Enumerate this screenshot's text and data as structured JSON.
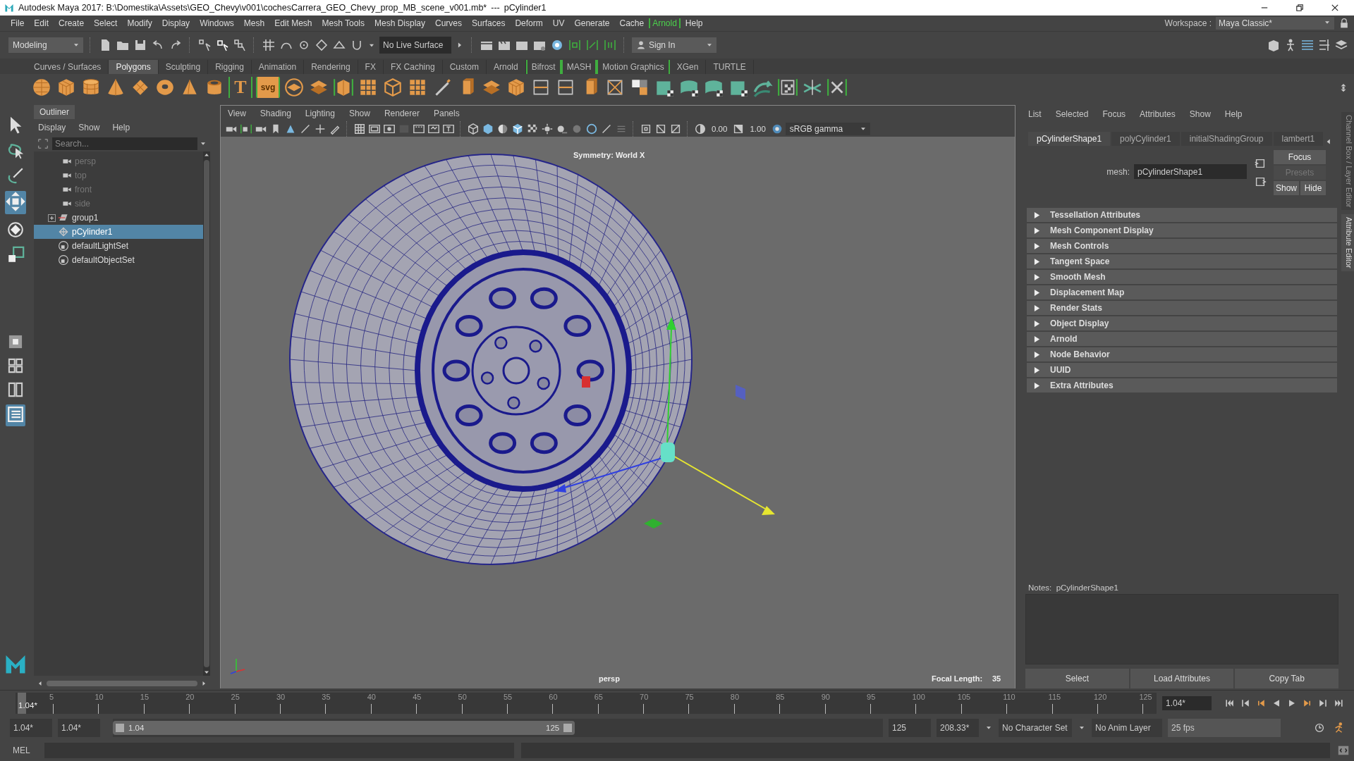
{
  "title_bar": {
    "title": "Autodesk Maya 2017: B:\\Domestika\\Assets\\GEO_Chevy\\v001\\cochesCarrera_GEO_Chevy_prop_MB_scene_v001.mb*",
    "separator": "---",
    "object": "pCylinder1"
  },
  "menu_bar": [
    {
      "label": "File",
      "highlighted": false
    },
    {
      "label": "Edit",
      "highlighted": false
    },
    {
      "label": "Create",
      "highlighted": false
    },
    {
      "label": "Select",
      "highlighted": false
    },
    {
      "label": "Modify",
      "highlighted": false
    },
    {
      "label": "Display",
      "highlighted": false
    },
    {
      "label": "Windows",
      "highlighted": false
    },
    {
      "label": "Mesh",
      "highlighted": false
    },
    {
      "label": "Edit Mesh",
      "highlighted": false
    },
    {
      "label": "Mesh Tools",
      "highlighted": false
    },
    {
      "label": "Mesh Display",
      "highlighted": false
    },
    {
      "label": "Curves",
      "highlighted": false
    },
    {
      "label": "Surfaces",
      "highlighted": false
    },
    {
      "label": "Deform",
      "highlighted": false
    },
    {
      "label": "UV",
      "highlighted": false
    },
    {
      "label": "Generate",
      "highlighted": false
    },
    {
      "label": "Cache",
      "highlighted": false
    },
    {
      "label": "Arnold",
      "highlighted": true
    },
    {
      "label": "Help",
      "highlighted": false
    }
  ],
  "workspace": {
    "label": "Workspace :",
    "value": "Maya Classic*"
  },
  "status_line": {
    "menu_set": "Modeling",
    "live_surface": "No Live Surface",
    "sign_in": "Sign In"
  },
  "shelf": {
    "tabs": [
      {
        "label": "Curves / Surfaces",
        "selected": false,
        "bracketed": false
      },
      {
        "label": "Polygons",
        "selected": true,
        "bracketed": false
      },
      {
        "label": "Sculpting",
        "selected": false,
        "bracketed": false
      },
      {
        "label": "Rigging",
        "selected": false,
        "bracketed": false
      },
      {
        "label": "Animation",
        "selected": false,
        "bracketed": false
      },
      {
        "label": "Rendering",
        "selected": false,
        "bracketed": false
      },
      {
        "label": "FX",
        "selected": false,
        "bracketed": false
      },
      {
        "label": "FX Caching",
        "selected": false,
        "bracketed": false
      },
      {
        "label": "Custom",
        "selected": false,
        "bracketed": false
      },
      {
        "label": "Arnold",
        "selected": false,
        "bracketed": false
      },
      {
        "label": "Bifrost",
        "selected": false,
        "bracketed": true
      },
      {
        "label": "MASH",
        "selected": false,
        "bracketed": true
      },
      {
        "label": "Motion Graphics",
        "selected": false,
        "bracketed": true
      },
      {
        "label": "XGen",
        "selected": false,
        "bracketed": false
      },
      {
        "label": "TURTLE",
        "selected": false,
        "bracketed": false
      }
    ],
    "text_tools": [
      "T",
      "svg"
    ]
  },
  "outliner": {
    "title": "Outliner",
    "menus": [
      "Display",
      "Show",
      "Help"
    ],
    "search": {
      "placeholder": "Search..."
    },
    "items": [
      {
        "name": "persp",
        "kind": "camera",
        "dimmed": true,
        "selected": false
      },
      {
        "name": "top",
        "kind": "camera",
        "dimmed": true,
        "selected": false
      },
      {
        "name": "front",
        "kind": "camera",
        "dimmed": true,
        "selected": false
      },
      {
        "name": "side",
        "kind": "camera",
        "dimmed": true,
        "selected": false
      },
      {
        "name": "group1",
        "kind": "group",
        "dimmed": false,
        "selected": false,
        "expanded": false
      },
      {
        "name": "pCylinder1",
        "kind": "mesh",
        "dimmed": false,
        "selected": true
      },
      {
        "name": "defaultLightSet",
        "kind": "set",
        "dimmed": false,
        "selected": false
      },
      {
        "name": "defaultObjectSet",
        "kind": "set",
        "dimmed": false,
        "selected": false
      }
    ]
  },
  "viewport": {
    "menus": [
      "View",
      "Shading",
      "Lighting",
      "Show",
      "Renderer",
      "Panels"
    ],
    "exposure": "0.00",
    "gamma": "1.00",
    "color_space": "sRGB gamma",
    "symmetry": "Symmetry: World X",
    "camera": "persp",
    "focal_length_label": "Focal Length:",
    "focal_length": "35"
  },
  "attribute_editor": {
    "menus": [
      "List",
      "Selected",
      "Focus",
      "Attributes",
      "Show",
      "Help"
    ],
    "tabs": [
      {
        "label": "pCylinderShape1",
        "selected": true
      },
      {
        "label": "polyCylinder1",
        "selected": false
      },
      {
        "label": "initialShadingGroup",
        "selected": false
      },
      {
        "label": "lambert1",
        "selected": false
      }
    ],
    "node_label": "mesh:",
    "node_name": "pCylinderShape1",
    "buttons": [
      {
        "label": "Focus",
        "disabled": false
      },
      {
        "label": "Presets",
        "disabled": true
      },
      {
        "label": "Show",
        "disabled": false
      },
      {
        "label": "Hide",
        "disabled": false
      }
    ],
    "sections": [
      {
        "label": "Tessellation Attributes",
        "expanded": false
      },
      {
        "label": "Mesh Component Display",
        "expanded": false
      },
      {
        "label": "Mesh Controls",
        "expanded": false
      },
      {
        "label": "Tangent Space",
        "expanded": false
      },
      {
        "label": "Smooth Mesh",
        "expanded": false
      },
      {
        "label": "Displacement Map",
        "expanded": false
      },
      {
        "label": "Render Stats",
        "expanded": false
      },
      {
        "label": "Object Display",
        "expanded": false
      },
      {
        "label": "Arnold",
        "expanded": false
      },
      {
        "label": "Node Behavior",
        "expanded": false
      },
      {
        "label": "UUID",
        "expanded": false
      },
      {
        "label": "Extra Attributes",
        "expanded": false
      }
    ],
    "notes_title": "Notes:  pCylinderShape1",
    "actions": [
      "Select",
      "Load Attributes",
      "Copy Tab"
    ]
  },
  "side_tabs": [
    {
      "label": "Channel Box / Layer Editor",
      "selected": false
    },
    {
      "label": "Attribute Editor",
      "selected": true
    }
  ],
  "time_slider": {
    "ticks": [
      "5",
      "10",
      "15",
      "20",
      "25",
      "30",
      "35",
      "40",
      "45",
      "50",
      "55",
      "60",
      "65",
      "70",
      "75",
      "80",
      "85",
      "90",
      "95",
      "100",
      "105",
      "110",
      "115",
      "120",
      "125"
    ],
    "current_frame": "1.04*",
    "current_field": "1.04*",
    "level": 0.002
  },
  "range_slider": {
    "start": "1.04*",
    "playback_start": "1.04*",
    "range_start": "1.04",
    "range_end": "125",
    "level": 0.6,
    "playback_end": "125",
    "end": "208.33*",
    "character_set": "No Character Set",
    "anim_layer": "No Anim Layer",
    "fps": "25 fps"
  },
  "command_line": {
    "language": "MEL"
  }
}
